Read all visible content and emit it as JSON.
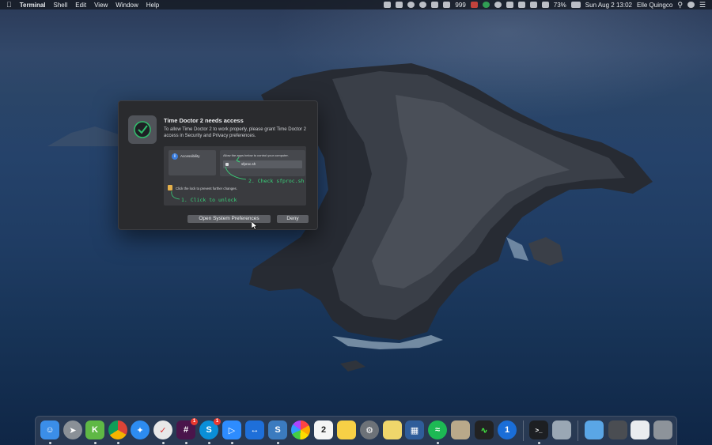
{
  "menubar": {
    "app_name": "Terminal",
    "menus": [
      "Shell",
      "Edit",
      "View",
      "Window",
      "Help"
    ],
    "mail_count": "999",
    "battery": "73%",
    "datetime": "Sun Aug 2  13:02",
    "user": "Elle Quingco"
  },
  "dialog": {
    "title": "Time Doctor 2 needs access",
    "message": "To allow Time Doctor 2 to work properly, please grant Time Doctor 2 access in Security and Privacy preferences.",
    "prefs_left_label": "Accessibility",
    "prefs_right_header": "Allow the apps below to control your computer.",
    "prefs_app_name": "sfproc.sh",
    "step2_text": "2. Check sfproc.sh",
    "lock_text": "Click the lock to prevent further changes.",
    "step1_text": "1. Click to unlock",
    "open_button": "Open System Preferences",
    "deny_button": "Deny"
  },
  "dock": {
    "calendar_day": "2",
    "badges": {
      "slack": "1",
      "skype": "1"
    }
  },
  "colors": {
    "step_annotation": "#39d37a",
    "dialog_bg": "#2a2b2e",
    "accent_blue": "#3b7ddd"
  }
}
